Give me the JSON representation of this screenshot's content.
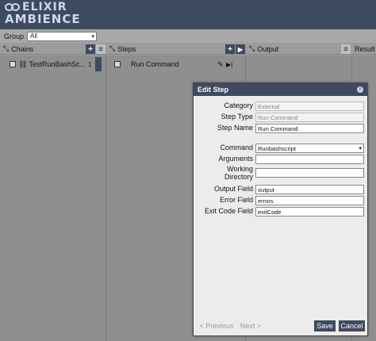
{
  "app": {
    "logo_line1": "ELIXIR",
    "logo_line2": "AMBIENCE"
  },
  "groupbar": {
    "label": "Group",
    "selected": "All"
  },
  "panels": {
    "chains": {
      "title": "Chains"
    },
    "steps": {
      "title": "Steps"
    },
    "output": {
      "title": "Output"
    },
    "results": {
      "title": "Result"
    }
  },
  "chains": {
    "items": [
      {
        "label": "TestRunBashSc...",
        "count": "1"
      }
    ]
  },
  "steps": {
    "items": [
      {
        "label": "Run Command"
      }
    ]
  },
  "modal": {
    "title": "Edit Step",
    "fields": {
      "category": {
        "label": "Category",
        "value": "External"
      },
      "step_type": {
        "label": "Step Type",
        "value": "Run Command"
      },
      "step_name": {
        "label": "Step Name",
        "value": "Run Command"
      },
      "command": {
        "label": "Command",
        "value": "Runbashscript"
      },
      "arguments": {
        "label": "Arguments",
        "value": ""
      },
      "working_dir": {
        "label_line1": "Working",
        "label_line2": "Directory",
        "value": ""
      },
      "output_field": {
        "label": "Output Field",
        "value": "output"
      },
      "error_field": {
        "label": "Error Field",
        "value": "errors"
      },
      "exit_code_field": {
        "label": "Exit Code Field",
        "value": "exitCode"
      }
    },
    "buttons": {
      "previous": "< Previous",
      "next": "Next >",
      "save": "Save",
      "cancel": "Cancel"
    }
  },
  "icons": {
    "panel_header": "collapse-arrows-icon",
    "add": "plus-icon",
    "menu": "hamburger-icon",
    "play": "play-icon",
    "edit": "pencil-icon",
    "step_run": "skip-forward-icon",
    "link": "link-icon",
    "info": "info-icon"
  },
  "colors": {
    "brand": "#3e4a5f",
    "overlay": "#9a9a9a",
    "modal_bg": "#ececec"
  }
}
